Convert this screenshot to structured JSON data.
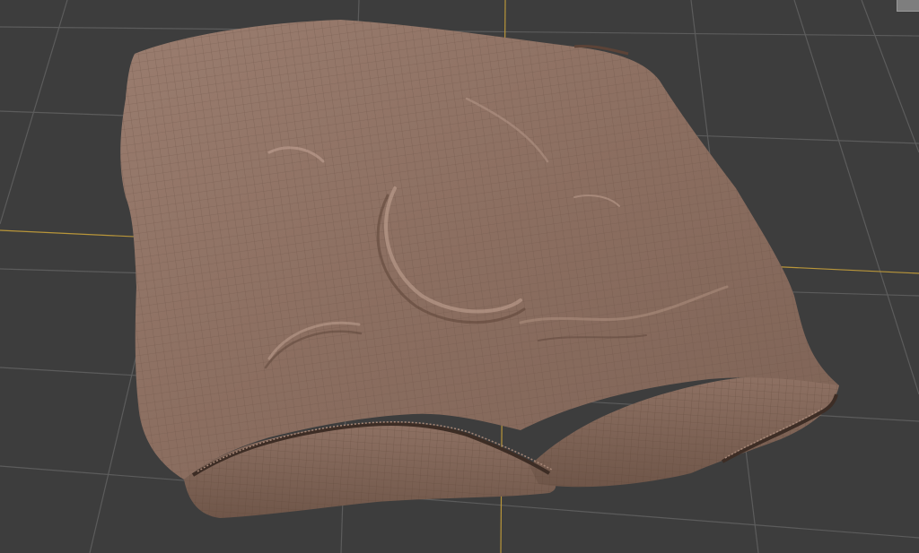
{
  "viewport": {
    "view_type": "perspective",
    "background_color": "#3d3d3d",
    "grid_color": "#5c5c5c",
    "axis_color": "#b9963a",
    "object": {
      "material_color": "#8a6d5f",
      "wireframe_color": "#6e5548",
      "highlight_color": "#c4a596"
    }
  },
  "viewcube": {
    "icon": "viewcube-icon"
  }
}
